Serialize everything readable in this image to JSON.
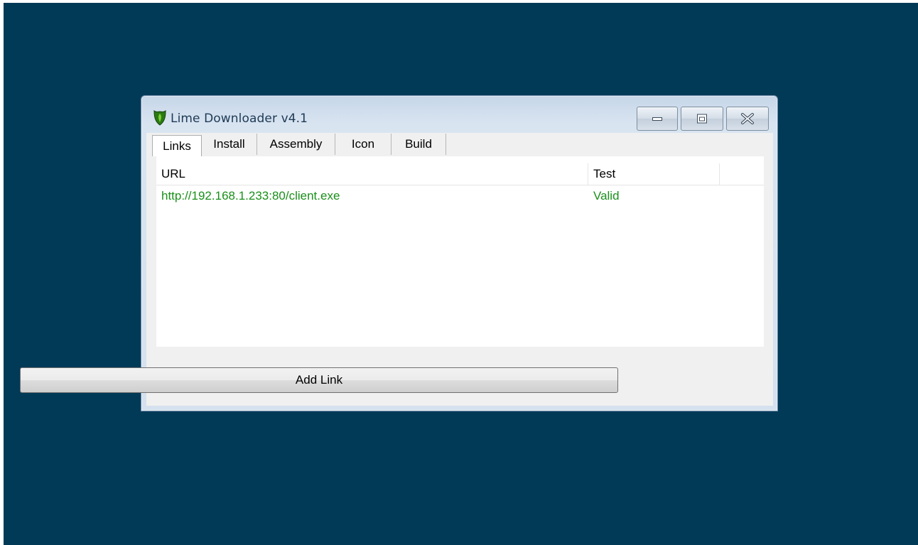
{
  "window": {
    "title": "Lime Downloader v4.1",
    "icon": "shield-icon"
  },
  "title_controls": {
    "minimize": "minimize-icon",
    "maximize": "maximize-icon",
    "close": "close-icon"
  },
  "tabs": [
    {
      "label": "Links",
      "active": true
    },
    {
      "label": "Install",
      "active": false
    },
    {
      "label": "Assembly",
      "active": false
    },
    {
      "label": "Icon",
      "active": false
    },
    {
      "label": "Build",
      "active": false
    }
  ],
  "links_list": {
    "columns": [
      "URL",
      "Test"
    ],
    "rows": [
      {
        "url": "http://192.168.1.233:80/client.exe",
        "test": "Valid"
      }
    ]
  },
  "add_button": {
    "label": "Add Link"
  },
  "colors": {
    "desktop": "#003a57",
    "valid_text": "#1a8f1a",
    "window_frame": "#d5e1ee"
  }
}
